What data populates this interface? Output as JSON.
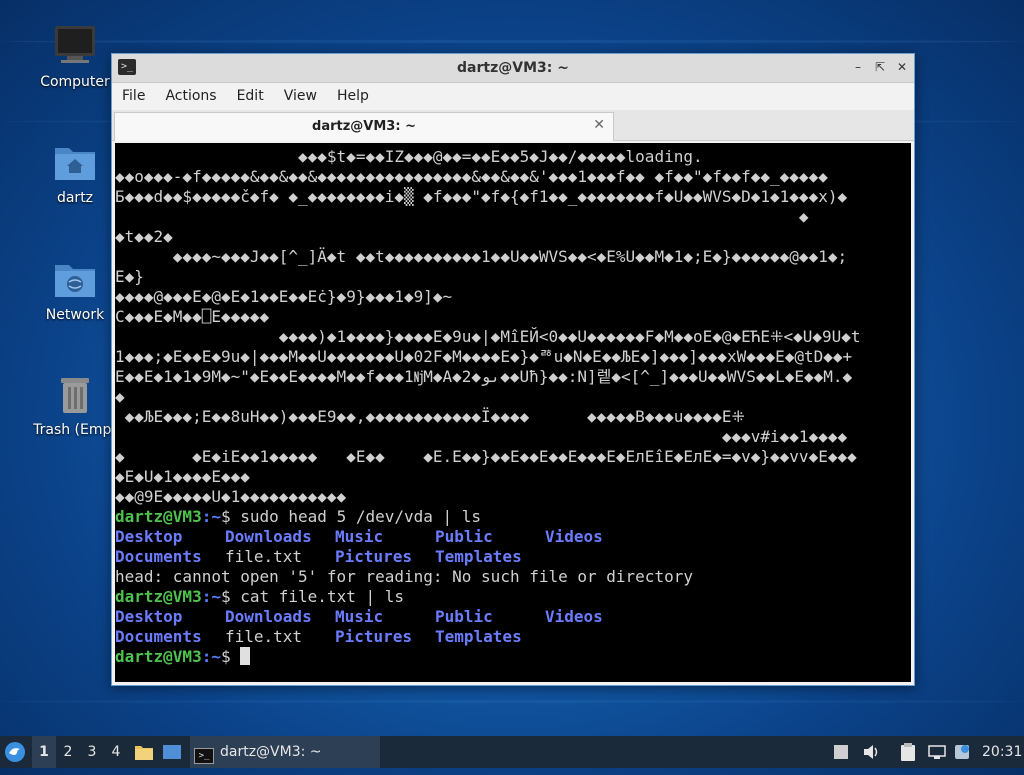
{
  "desktop": {
    "icons": [
      {
        "label": "Computer"
      },
      {
        "label": "dartz"
      },
      {
        "label": "Network"
      },
      {
        "label": "Trash (Empt"
      }
    ]
  },
  "window": {
    "title": "dartz@VM3: ~",
    "menu": [
      "File",
      "Actions",
      "Edit",
      "View",
      "Help"
    ],
    "tab_label": "dartz@VM3: ~"
  },
  "terminal": {
    "garbage_lines": [
      "                   ◆◆◆$t◆=◆◆IZ◆◆◆@◆◆=◆◆E◆◆5◆J◆◆/◆◆◆◆◆loading.",
      "◆◆o◆◆◆-◆f◆◆◆◆◆&◆◆&◆◆&◆◆◆◆◆◆◆◆◆◆◆◆◆◆◆◆&◆◆&◆◆&'◆◆◆1◆◆◆f◆◆ ◆f◆◆\"◆f◆◆f◆◆_◆◆◆◆◆",
      "Б◆◆◆d◆◆$◆◆◆◆◆č◆f◆ ◆_◆◆◆◆◆◆◆◆i◆▒ ◆f◆◆◆\"◆f◆{◆f1◆◆_◆◆◆◆◆◆◆◆f◆U◆◆WVS◆D◆1◆1◆◆◆x)◆",
      "                                                                       ◆",
      "◆t◆◆2◆",
      "      ◆◆◆◆~◆◆◆J◆◆[^_]Ä◆t ◆◆t◆◆◆◆◆◆◆◆◆◆1◆◆U◆◆WVS◆◆<◆E%U◆◆M◆1◆;E◆}◆◆◆◆◆◆@◆◆1◆;",
      "E◆}",
      "◆◆◆◆@◆◆◆E◆@◆E◆1◆◆E◆◆Eċ}◆9}◆◆◆1◆9]◆~",
      "C◆◆◆E◆M◆◆⎕E◆◆◆◆◆",
      "                 ◆◆◆◆)◆1◆◆◆◆}◆◆◆◆E◆9u◆|◆MîEЙ<0◆◆U◆◆◆◆◆◆F◆M◆◆oE◆@◆EЋE⁜<◆U◆9U◆t",
      "1◆◆◆;◆E◆◆E◆9u◆|◆◆◆M◆◆U◆◆◆◆◆◆◆U◆02F◆M◆◆◆◆E◆}◆ᄚu◆N◆E◆◆ЉE◆]◆◆◆]◆◆◆xW◆◆◆E◆@tD◆◆+",
      "E◆◆E◆1◆1◆9M◆~\"◆E◆◆E◆◆◆◆M◆◆f◆◆◆1ǋM◆A◆2◆ىو◆◆Uħ}◆◆:N]렡◆<[^_]◆◆◆U◆◆WVS◆◆L◆E◆◆M.◆",
      "◆",
      " ◆◆ЉE◆◆◆;E◆◆8uH◆◆)◆◆◆E9◆◆,◆◆◆◆◆◆◆◆◆◆◆◆Ї◆◆◆◆      ◆◆◆◆◆B◆◆◆u◆◆◆◆E⁜",
      "                                                               ◆◆◆v#i◆◆1◆◆◆◆",
      "◆       ◆E◆iE◆◆1◆◆◆◆◆   ◆E◆◆    ◆E.E◆◆}◆◆E◆◆E◆◆E◆◆◆E◆EлEîE◆EлE◆=◆v◆}◆◆vv◆E◆◆◆",
      "◆E◆U◆1◆◆◆◆E◆◆◆",
      "◆◆@9E◆◆◆◆◆U◆1◆◆◆◆◆◆◆◆◆◆◆"
    ],
    "prompt_user": "dartz@VM3",
    "prompt_path": ":~",
    "prompt_symbol": "$",
    "cmd1": " sudo head 5 /dev/vda | ls",
    "cmd2": " cat file.txt | ls",
    "ls_row1": [
      "Desktop",
      "Downloads",
      "Music",
      "Public",
      "Videos"
    ],
    "ls_row2": [
      "Documents",
      "file.txt",
      "Pictures",
      "Templates"
    ],
    "error_line": "head: cannot open '5' for reading: No such file or directory"
  },
  "taskbar": {
    "workspaces": [
      "1",
      "2",
      "3",
      "4"
    ],
    "active_window": "dartz@VM3: ~",
    "clock": "20:31"
  }
}
